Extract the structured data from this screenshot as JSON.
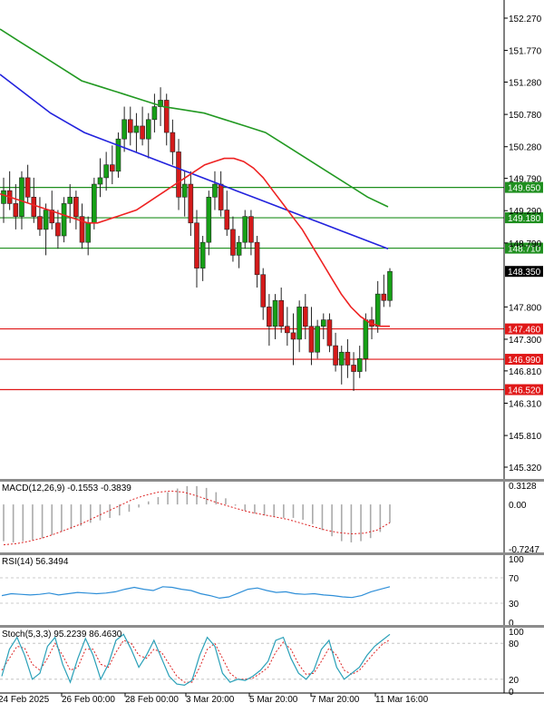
{
  "chart_data": [
    {
      "type": "candlestick",
      "name": "price",
      "ylim": [
        145.32,
        152.27
      ],
      "y_ticks": [
        "152.270",
        "151.770",
        "151.280",
        "150.780",
        "150.280",
        "149.790",
        "149.290",
        "148.790",
        "147.800",
        "147.300",
        "146.810",
        "146.310",
        "145.810",
        "145.320"
      ],
      "x_ticks": [
        "24 Feb 2025",
        "26 Feb 00:00",
        "28 Feb 00:00",
        "3 Mar 20:00",
        "5 Mar 20:00",
        "7 Mar 20:00",
        "11 Mar 16:00"
      ],
      "current_price": "148.350",
      "resistance_levels": [
        "149.650",
        "149.180",
        "148.710"
      ],
      "support_levels": [
        "147.460",
        "146.990",
        "146.520"
      ],
      "candles": [
        [
          149.4,
          149.8,
          149.1,
          149.6
        ],
        [
          149.6,
          149.9,
          149.3,
          149.4
        ],
        [
          149.4,
          149.7,
          149.0,
          149.2
        ],
        [
          149.2,
          149.9,
          149.0,
          149.8
        ],
        [
          149.8,
          150.0,
          149.4,
          149.5
        ],
        [
          149.5,
          149.8,
          149.1,
          149.2
        ],
        [
          149.2,
          149.5,
          148.9,
          149.0
        ],
        [
          149.0,
          149.4,
          148.6,
          149.3
        ],
        [
          149.3,
          149.6,
          149.0,
          149.1
        ],
        [
          149.1,
          149.3,
          148.7,
          148.9
        ],
        [
          148.9,
          149.5,
          148.8,
          149.4
        ],
        [
          149.4,
          149.7,
          149.1,
          149.5
        ],
        [
          149.5,
          149.6,
          149.0,
          149.2
        ],
        [
          149.2,
          149.4,
          148.7,
          148.8
        ],
        [
          148.8,
          149.2,
          148.6,
          149.1
        ],
        [
          149.1,
          149.8,
          149.0,
          149.7
        ],
        [
          149.7,
          150.1,
          149.5,
          149.8
        ],
        [
          149.8,
          150.2,
          149.6,
          150.0
        ],
        [
          150.0,
          150.3,
          149.7,
          149.9
        ],
        [
          149.9,
          150.5,
          149.8,
          150.4
        ],
        [
          150.4,
          150.9,
          150.2,
          150.7
        ],
        [
          150.7,
          150.9,
          150.3,
          150.5
        ],
        [
          150.5,
          150.8,
          150.2,
          150.6
        ],
        [
          150.6,
          150.9,
          150.3,
          150.4
        ],
        [
          150.4,
          150.8,
          150.1,
          150.7
        ],
        [
          150.7,
          151.1,
          150.5,
          150.9
        ],
        [
          150.9,
          151.2,
          150.6,
          151.0
        ],
        [
          151.0,
          151.1,
          150.3,
          150.5
        ],
        [
          150.5,
          150.7,
          150.0,
          150.2
        ],
        [
          150.2,
          150.4,
          149.3,
          149.5
        ],
        [
          149.5,
          149.9,
          149.2,
          149.7
        ],
        [
          149.7,
          149.9,
          148.9,
          149.1
        ],
        [
          149.1,
          149.3,
          148.1,
          148.4
        ],
        [
          148.4,
          148.9,
          148.2,
          148.8
        ],
        [
          148.8,
          149.6,
          148.6,
          149.5
        ],
        [
          149.5,
          149.9,
          149.3,
          149.7
        ],
        [
          149.7,
          149.9,
          149.2,
          149.3
        ],
        [
          149.3,
          149.6,
          148.9,
          149.0
        ],
        [
          149.0,
          149.2,
          148.5,
          148.6
        ],
        [
          148.6,
          148.9,
          148.4,
          148.8
        ],
        [
          148.8,
          149.3,
          148.7,
          149.2
        ],
        [
          149.2,
          149.3,
          148.6,
          148.8
        ],
        [
          148.8,
          148.9,
          148.1,
          148.3
        ],
        [
          148.3,
          148.4,
          147.6,
          147.8
        ],
        [
          147.8,
          148.0,
          147.2,
          147.5
        ],
        [
          147.5,
          148.0,
          147.3,
          147.9
        ],
        [
          147.9,
          148.1,
          147.4,
          147.5
        ],
        [
          147.5,
          147.8,
          147.2,
          147.4
        ],
        [
          147.4,
          147.7,
          146.9,
          147.3
        ],
        [
          147.3,
          147.9,
          147.1,
          147.8
        ],
        [
          147.8,
          148.0,
          147.3,
          147.5
        ],
        [
          147.5,
          147.8,
          146.9,
          147.1
        ],
        [
          147.1,
          147.6,
          147.0,
          147.5
        ],
        [
          147.5,
          147.7,
          147.3,
          147.6
        ],
        [
          147.6,
          147.7,
          147.1,
          147.2
        ],
        [
          147.2,
          147.4,
          146.8,
          146.9
        ],
        [
          146.9,
          147.2,
          146.6,
          147.1
        ],
        [
          147.1,
          147.3,
          146.7,
          146.9
        ],
        [
          146.9,
          147.1,
          146.5,
          146.8
        ],
        [
          146.8,
          147.2,
          146.7,
          147.0
        ],
        [
          147.0,
          147.7,
          146.8,
          147.6
        ],
        [
          147.6,
          147.8,
          147.3,
          147.5
        ],
        [
          147.5,
          148.2,
          147.4,
          148.0
        ],
        [
          148.0,
          148.3,
          147.8,
          147.9
        ],
        [
          147.9,
          148.4,
          147.8,
          148.35
        ]
      ],
      "ma_red": [
        149.55,
        149.5,
        149.45,
        149.4,
        149.35,
        149.3,
        149.25,
        149.2,
        149.15,
        149.1,
        149.1,
        149.15,
        149.2,
        149.25,
        149.3,
        149.4,
        149.5,
        149.6,
        149.7,
        149.8,
        149.9,
        150.0,
        150.05,
        150.1,
        150.1,
        150.05,
        149.95,
        149.8,
        149.6,
        149.4,
        149.2,
        149.0,
        148.75,
        148.5,
        148.25,
        148.0,
        147.8,
        147.65,
        147.55,
        147.5,
        147.5
      ],
      "ma_blue": [
        151.4,
        151.2,
        151.0,
        150.8,
        150.65,
        150.5,
        150.4,
        150.3,
        150.2,
        150.1,
        150.0,
        149.9,
        149.8,
        149.7,
        149.6,
        149.5,
        149.4,
        149.3,
        149.2,
        149.1,
        149.0,
        148.9,
        148.8,
        148.7
      ],
      "ma_green": [
        152.1,
        151.9,
        151.7,
        151.5,
        151.3,
        151.2,
        151.1,
        151.0,
        150.9,
        150.85,
        150.8,
        150.7,
        150.6,
        150.5,
        150.3,
        150.1,
        149.9,
        149.7,
        149.5,
        149.35
      ],
      "series": [
        {
          "name": "",
          "color": "#ee2222"
        },
        {
          "name": "",
          "color": "#2222dd"
        },
        {
          "name": "",
          "color": "#229922"
        }
      ]
    },
    {
      "type": "bar",
      "name": "macd",
      "label": "MACD(12,26,9) -0.1553 -0.3839",
      "ylim": [
        -0.7247,
        0.3128
      ],
      "y_ticks": [
        "0.3128",
        "0.00",
        "-0.7247"
      ],
      "values": [
        -0.6,
        -0.62,
        -0.6,
        -0.58,
        -0.55,
        -0.5,
        -0.45,
        -0.4,
        -0.35,
        -0.3,
        -0.26,
        -0.22,
        -0.18,
        -0.12,
        -0.05,
        0.05,
        0.12,
        0.2,
        0.26,
        0.3,
        0.3,
        0.27,
        0.2,
        0.1,
        -0.02,
        -0.1,
        -0.15,
        -0.18,
        -0.2,
        -0.22,
        -0.22,
        -0.25,
        -0.32,
        -0.42,
        -0.52,
        -0.6,
        -0.62,
        -0.6,
        -0.55,
        -0.45,
        -0.3
      ],
      "signal": [
        -0.66,
        -0.64,
        -0.6,
        -0.55,
        -0.48,
        -0.4,
        -0.32,
        -0.22,
        -0.12,
        -0.02,
        0.08,
        0.15,
        0.2,
        0.22,
        0.2,
        0.14,
        0.07,
        0.0,
        -0.06,
        -0.12,
        -0.16,
        -0.2,
        -0.24,
        -0.3,
        -0.36,
        -0.42,
        -0.46,
        -0.48,
        -0.47,
        -0.42,
        -0.3
      ],
      "color": "#aaaaaa",
      "signal_color": "#dd2222"
    },
    {
      "type": "line",
      "name": "rsi",
      "label": "RSI(14) 56.3494",
      "ylim": [
        0,
        100
      ],
      "y_ticks": [
        "100",
        "70",
        "30",
        "0"
      ],
      "values": [
        42,
        45,
        44,
        43,
        44,
        46,
        43,
        45,
        47,
        46,
        45,
        46,
        48,
        52,
        55,
        52,
        50,
        56,
        55,
        52,
        50,
        45,
        42,
        38,
        40,
        46,
        52,
        54,
        50,
        47,
        48,
        45,
        44,
        45,
        43,
        42,
        40,
        39,
        42,
        48,
        52,
        56
      ],
      "color": "#2f8fd8"
    },
    {
      "type": "line",
      "name": "stoch",
      "label": "Stoch(5,3,3) 95.2239 86.4630",
      "ylim": [
        0,
        100
      ],
      "y_ticks": [
        "100",
        "80",
        "20",
        "0"
      ],
      "values": [
        25,
        70,
        90,
        60,
        20,
        30,
        75,
        90,
        45,
        15,
        55,
        88,
        60,
        20,
        45,
        85,
        95,
        70,
        40,
        60,
        85,
        55,
        25,
        12,
        10,
        18,
        60,
        90,
        75,
        30,
        15,
        20,
        18,
        25,
        35,
        50,
        85,
        90,
        55,
        30,
        20,
        35,
        70,
        85,
        40,
        20,
        30,
        40,
        60,
        75,
        85,
        95
      ],
      "signal": [
        35,
        55,
        75,
        72,
        45,
        35,
        55,
        80,
        60,
        35,
        40,
        70,
        70,
        45,
        40,
        65,
        85,
        80,
        60,
        55,
        70,
        65,
        45,
        25,
        15,
        15,
        40,
        70,
        80,
        55,
        30,
        20,
        20,
        22,
        30,
        40,
        65,
        82,
        70,
        45,
        28,
        30,
        50,
        72,
        60,
        35,
        28,
        35,
        50,
        65,
        78,
        86
      ],
      "color": "#2aa0b8",
      "signal_color": "#dd2222"
    }
  ]
}
